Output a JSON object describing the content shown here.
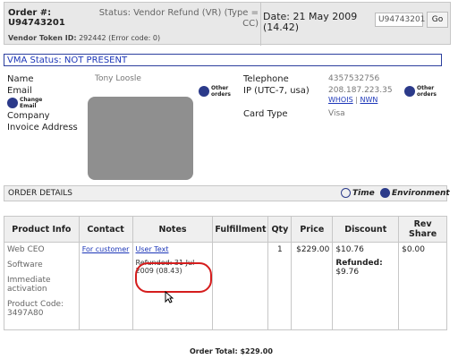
{
  "topbar": {
    "order_label": "Order #:",
    "order_value": "U94743201",
    "status": "Status: Vendor Refund (VR) (Type = CC)",
    "date_line1": "Date: 21 May 2009",
    "date_line2": "(14.42)",
    "search_value": "U94743201",
    "go_label": "Go",
    "vendor_token_label": "Vendor Token ID:",
    "vendor_token_value": "292442 (Error code: 0)"
  },
  "vma_status": "VMA Status: NOT PRESENT",
  "customer": {
    "name_label": "Name",
    "name_value": "Tony Loosle",
    "email_label": "Email",
    "change_email": "Change Email",
    "company_label": "Company",
    "invoice_label": "Invoice Address",
    "other_orders": "Other orders",
    "telephone_label": "Telephone",
    "telephone_value": "4357532756",
    "ip_label": "IP (UTC-7, usa)",
    "ip_value": "208.187.223.35",
    "whois": "WHOIS",
    "nwn": "NWN",
    "card_type_label": "Card Type",
    "card_type_value": "Visa",
    "other_orders_2": "Other orders"
  },
  "order_details": {
    "title": "ORDER DETAILS",
    "time_label": "Time",
    "environment_label": "Environment"
  },
  "table": {
    "headers": [
      "Product Info",
      "Contact",
      "Notes",
      "Fulfillment",
      "Qty",
      "Price",
      "Discount",
      "Rev Share"
    ],
    "product_info": [
      "Web CEO",
      "Software",
      "Immediate activation",
      "Product Code: 3497A80"
    ],
    "contact": "For customer",
    "notes_link": "User Text",
    "notes_refund": "Refunded: 31 Jul 2009 (08.43)",
    "fulfillment": "",
    "qty": "1",
    "price": "$229.00",
    "discount_value": "$10.76",
    "discount_refunded_label": "Refunded:",
    "discount_refunded_value": "$9.76",
    "rev_share": "$0.00"
  },
  "order_total": "Order Total: $229.00",
  "colors": {
    "accent_blue": "#1c36b8",
    "highlight_red": "#d51d1d",
    "header_gray": "#e8e8e8"
  }
}
